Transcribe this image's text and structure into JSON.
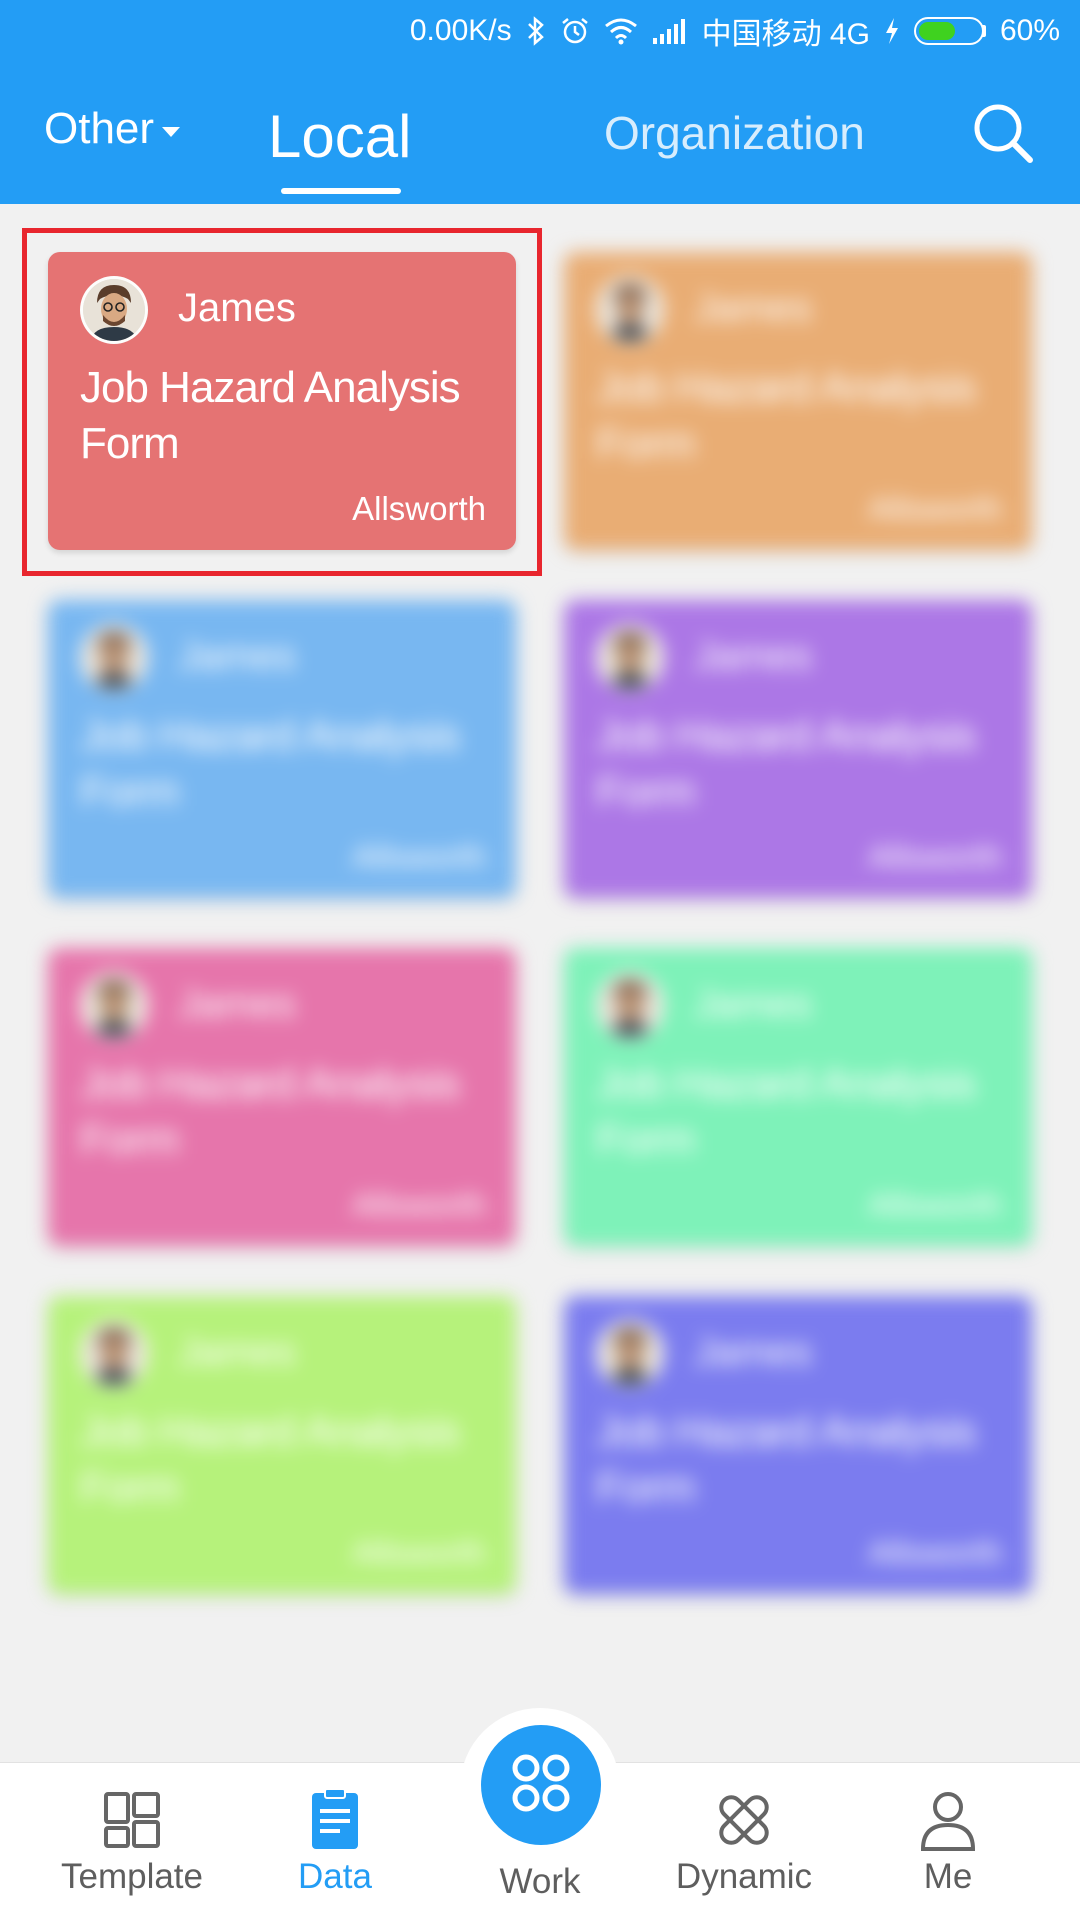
{
  "status_bar": {
    "speed": "0.00K/s",
    "carrier": "中国移动 4G",
    "battery": "60%",
    "battery_level": 0.6,
    "icons": [
      "bluetooth-icon",
      "alarm-icon",
      "wifi-icon",
      "signal-icon",
      "charging-icon",
      "battery-icon"
    ]
  },
  "top_nav": {
    "other_label": "Other",
    "local_label": "Local",
    "org_label": "Organization",
    "active_tab": "Local",
    "search_icon": "search-icon"
  },
  "cards": [
    {
      "author": "James",
      "title": "Job Hazard Analysis Form",
      "org": "Allsworth",
      "color": "#e57373",
      "highlighted": true
    },
    {
      "author": "James",
      "title": "Job Hazard Analysis Form",
      "org": "Allsworth",
      "color": "#e9ad74"
    },
    {
      "author": "James",
      "title": "Job Hazard Analysis Form",
      "org": "Allsworth",
      "color": "#78b7f1"
    },
    {
      "author": "James",
      "title": "Job Hazard Analysis Form",
      "org": "Allsworth",
      "color": "#ac77e6"
    },
    {
      "author": "James",
      "title": "Job Hazard Analysis Form",
      "org": "Allsworth",
      "color": "#e675ab"
    },
    {
      "author": "James",
      "title": "Job Hazard Analysis Form",
      "org": "Allsworth",
      "color": "#7ef2b9"
    },
    {
      "author": "James",
      "title": "Job Hazard Analysis Form",
      "org": "Allsworth",
      "color": "#b6f27b"
    },
    {
      "author": "James",
      "title": "Job Hazard Analysis Form",
      "org": "Allsworth",
      "color": "#7b7cef"
    }
  ],
  "colors": {
    "brand": "#239df5",
    "highlight": "#e8262e"
  },
  "bottom_nav": {
    "template": "Template",
    "data": "Data",
    "work": "Work",
    "dynamic": "Dynamic",
    "me": "Me",
    "active": "Data"
  }
}
